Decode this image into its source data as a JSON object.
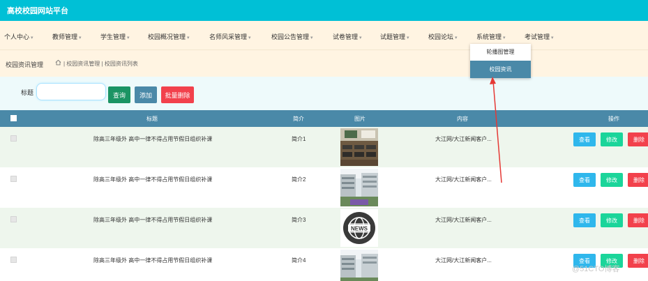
{
  "app": {
    "title": "高校校园网站平台"
  },
  "menu": [
    {
      "label": "个人中心"
    },
    {
      "label": "教师管理"
    },
    {
      "label": "学生管理"
    },
    {
      "label": "校园概况管理"
    },
    {
      "label": "名师风采管理"
    },
    {
      "label": "校园公告管理"
    },
    {
      "label": "试卷管理"
    },
    {
      "label": "试题管理"
    },
    {
      "label": "校园论坛"
    },
    {
      "label": "系统管理"
    },
    {
      "label": "考试管理"
    }
  ],
  "dropdown": {
    "items": [
      {
        "label": "轮播图管理"
      },
      {
        "label": "校园资讯"
      }
    ]
  },
  "breadcrumb": {
    "page_title": "校园资讯管理",
    "path": "| 校园资讯管理 | 校园资讯列表"
  },
  "search": {
    "label": "标题",
    "value": "",
    "search_label": "查询",
    "add_label": "添加",
    "batch_delete_label": "批量删除"
  },
  "table": {
    "headers": {
      "title": "标题",
      "intro": "简介",
      "image": "图片",
      "content": "内容",
      "ops": "操作"
    },
    "rows": [
      {
        "title": "除高三年级外 高中一律不得占用节假日组织补课",
        "intro": "简介1",
        "image": "classroom-photo",
        "content": "大江网/大江新闻客户...",
        "view": "查看",
        "edit": "修改",
        "del": "删除"
      },
      {
        "title": "除高三年级外 高中一律不得占用节假日组织补课",
        "intro": "简介2",
        "image": "campus-building-photo",
        "content": "大江网/大江新闻客户...",
        "view": "查看",
        "edit": "修改",
        "del": "删除"
      },
      {
        "title": "除高三年级外 高中一律不得占用节假日组织补课",
        "intro": "简介3",
        "image": "news-globe-icon",
        "content": "大江网/大江新闻客户...",
        "view": "查看",
        "edit": "修改",
        "del": "删除"
      },
      {
        "title": "除高三年级外 高中一律不得占用节假日组织补课",
        "intro": "简介4",
        "image": "campus-building-photo",
        "content": "大江网/大江新闻客户...",
        "view": "查看",
        "edit": "修改",
        "del": "删除"
      }
    ]
  },
  "overlay": {
    "news_badge_text": "NEWS",
    "watermark": "@51CTO博客"
  },
  "colors": {
    "topbar": "#00c0d6",
    "menubar": "#fff4e2",
    "table_header": "#4a89a8",
    "view_button": "#2fb7ec",
    "edit_button": "#1bd59a",
    "delete_button": "#f2414c",
    "arrow": "#e53935"
  }
}
